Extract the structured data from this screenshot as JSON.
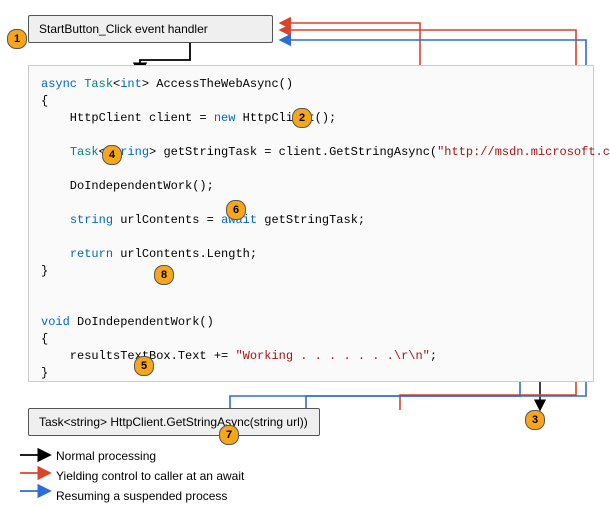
{
  "boxes": {
    "caller": "StartButton_Click event handler",
    "callee": "Task<string> HttpClient.GetStringAsync(string url))"
  },
  "code": {
    "sig_async": "async",
    "sig_task": "Task",
    "sig_int": "int",
    "sig_name": "> AccessTheWebAsync()",
    "brace_open": "{",
    "l1a": "    HttpClient client = ",
    "l1b": "new",
    "l1c": " HttpClient();",
    "l2a": "Task",
    "l2b": "string",
    "l2c": "> getStringTask = client.GetStringAsync(",
    "l2d": "\"http://msdn.microsoft.com\"",
    "l2e": ");",
    "l3": "    DoIndependentWork();",
    "l4a": "string",
    "l4b": " urlContents = ",
    "l4c": "await",
    "l4d": " getStringTask;",
    "l5a": "return",
    "l5b": " urlContents.Length;",
    "brace_close": "}",
    "d1a": "void",
    "d1b": " DoIndependentWork()",
    "d_open": "{",
    "d2a": "    resultsTextBox.Text += ",
    "d2b": "\"Working . . . . . . .\\r\\n\"",
    "d2c": ";",
    "d_close": "}"
  },
  "badges": {
    "b1": "1",
    "b2": "2",
    "b3": "3",
    "b4": "4",
    "b5": "5",
    "b6": "6",
    "b7": "7",
    "b8": "8"
  },
  "legend": {
    "normal": "Normal processing",
    "yield": "Yielding control to caller at an await",
    "resume": "Resuming a suspended process"
  }
}
